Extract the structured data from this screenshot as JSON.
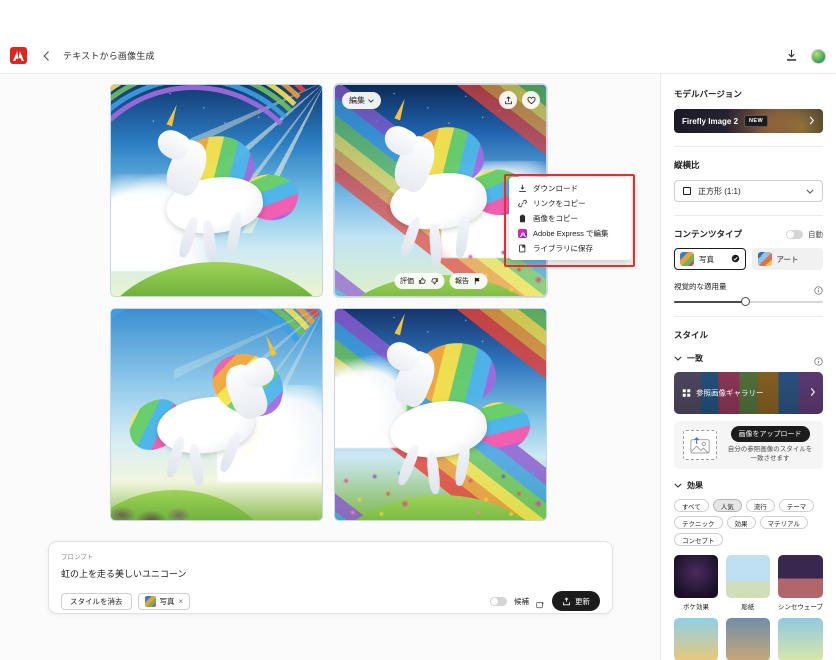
{
  "header": {
    "logo": "adobe-logo",
    "back": "back-chevron-icon",
    "title": "テキストから画像生成",
    "download_icon": "download-tray-icon",
    "avatar": "user-avatar"
  },
  "results": {
    "images": [
      {
        "alt": "虹とユニコーン 1"
      },
      {
        "alt": "虹とユニコーン 2"
      },
      {
        "alt": "虹とユニコーン 3"
      },
      {
        "alt": "虹とユニコーン 4"
      }
    ],
    "overlay": {
      "edit_label": "編集",
      "share_icon": "share-icon",
      "favorite_icon": "heart-icon",
      "rate_label": "評価",
      "thumbs_up_icon": "thumbs-up-icon",
      "thumbs_down_icon": "thumbs-down-icon",
      "report_label": "報告",
      "flag_icon": "flag-icon"
    }
  },
  "context_menu": {
    "highlight_color": "#ee2b27",
    "items": [
      {
        "label": "ダウンロード",
        "icon": "download-icon"
      },
      {
        "label": "リンクをコピー",
        "icon": "link-icon"
      },
      {
        "label": "画像をコピー",
        "icon": "clipboard-icon"
      },
      {
        "label": "Adobe Express で編集",
        "icon": "adobe-express-icon"
      },
      {
        "label": "ライブラリに保存",
        "icon": "library-save-icon"
      }
    ]
  },
  "sidebar": {
    "model_version": {
      "title": "モデルバージョン",
      "name": "Firefly Image 2",
      "badge": "NEW",
      "chevron": "chevron-right-icon"
    },
    "aspect_ratio": {
      "title": "縦横比",
      "value": "正方形 (1:1)",
      "icon": "square-icon",
      "chevron": "chevron-down-icon"
    },
    "content_type": {
      "title": "コンテンツタイプ",
      "auto_label": "自動",
      "auto_on": false,
      "options": [
        {
          "label": "写真",
          "selected": true
        },
        {
          "label": "アート",
          "selected": false
        }
      ]
    },
    "visual_intensity": {
      "title": "視覚的な適用量",
      "info_icon": "info-icon",
      "value": 60
    },
    "style": {
      "title": "スタイル",
      "match": {
        "label": "一致",
        "chevron": "chevron-down-icon",
        "info_icon": "info-icon"
      },
      "gallery_label": "参照画像ギャラリー",
      "gallery_icon": "grid-icon",
      "gallery_chevron": "chevron-right-icon",
      "upload_button": "画像をアップロード",
      "upload_description": "自分の参照画像のスタイルを一致させます",
      "upload_icon": "image-upload-icon"
    },
    "effects": {
      "title": "効果",
      "chevron": "chevron-down-icon",
      "filters": [
        {
          "label": "すべて",
          "active": false
        },
        {
          "label": "人気",
          "active": true
        },
        {
          "label": "流行",
          "active": false
        },
        {
          "label": "テーマ",
          "active": false
        },
        {
          "label": "テクニック",
          "active": false
        },
        {
          "label": "効果",
          "active": false
        },
        {
          "label": "マテリアル",
          "active": false
        },
        {
          "label": "コンセプト",
          "active": false
        }
      ],
      "items": [
        {
          "label": "ボケ効果"
        },
        {
          "label": "彫紙"
        },
        {
          "label": "シンセウェーブ"
        },
        {
          "label": ""
        },
        {
          "label": ""
        },
        {
          "label": ""
        }
      ]
    }
  },
  "prompt_bar": {
    "label": "プロンプト",
    "text": "虹の上を走る美しいユニコーン",
    "clear_style_button": "スタイルを消去",
    "style_chip": {
      "label": "写真",
      "remove": "×"
    },
    "suggestions_label": "候補",
    "suggestions_on": false,
    "suggestions_icon": "sparkle-icon",
    "refresh_button": "更新",
    "refresh_icon": "refresh-icon"
  }
}
